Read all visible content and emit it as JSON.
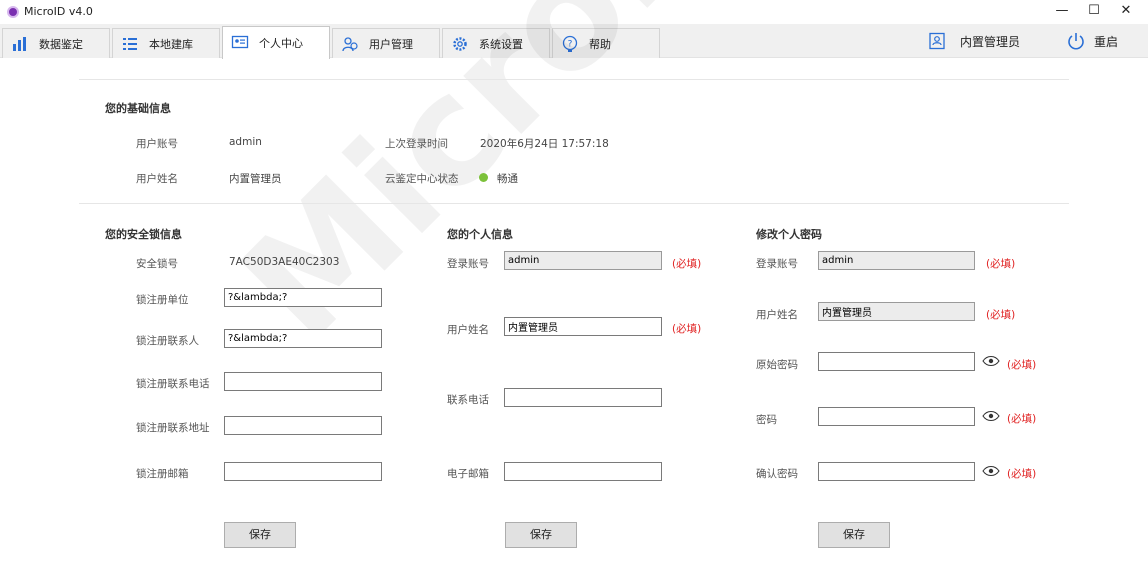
{
  "window": {
    "title": "MicroID v4.0",
    "minimize": "—",
    "maximize": "☐",
    "close": "✕"
  },
  "tabs": [
    {
      "label": "数据鉴定",
      "icon": "chart-icon"
    },
    {
      "label": "本地建库",
      "icon": "list-icon"
    },
    {
      "label": "个人中心",
      "icon": "id-card-icon",
      "active": true
    },
    {
      "label": "用户管理",
      "icon": "users-icon"
    },
    {
      "label": "系统设置",
      "icon": "gear-icon"
    },
    {
      "label": "帮助",
      "icon": "help-icon"
    }
  ],
  "header": {
    "user_name": "内置管理员",
    "restart_label": "重启"
  },
  "watermark": "MicroID",
  "basic_info": {
    "title": "您的基础信息",
    "account_label": "用户账号",
    "account_value": "admin",
    "last_login_label": "上次登录时间",
    "last_login_value": "2020年6月24日 17:57:18",
    "name_label": "用户姓名",
    "name_value": "内置管理员",
    "cloud_label": "云鉴定中心状态",
    "cloud_value": "畅通",
    "cloud_color": "#7cc13a"
  },
  "lock_info": {
    "title": "您的安全锁信息",
    "lock_no_label": "安全锁号",
    "lock_no_value": "7AC50D3AE40C2303",
    "unit_label": "锁注册单位",
    "unit_value": "?&lambda;?",
    "contact_label": "锁注册联系人",
    "contact_value": "?&lambda;?",
    "phone_label": "锁注册联系电话",
    "phone_value": "",
    "address_label": "锁注册联系地址",
    "address_value": "",
    "email_label": "锁注册邮箱",
    "email_value": "",
    "save_label": "保存"
  },
  "personal_info": {
    "title": "您的个人信息",
    "login_label": "登录账号",
    "login_value": "admin",
    "name_label": "用户姓名",
    "name_value": "内置管理员",
    "phone_label": "联系电话",
    "phone_value": "",
    "email_label": "电子邮箱",
    "email_value": "",
    "required": "(必填)",
    "save_label": "保存"
  },
  "password": {
    "title": "修改个人密码",
    "login_label": "登录账号",
    "login_value": "admin",
    "name_label": "用户姓名",
    "name_value": "内置管理员",
    "old_label": "原始密码",
    "new_label": "密码",
    "confirm_label": "确认密码",
    "required": "(必填)",
    "save_label": "保存"
  },
  "colors": {
    "required": "#e02020",
    "accent": "#2a6fd6"
  }
}
